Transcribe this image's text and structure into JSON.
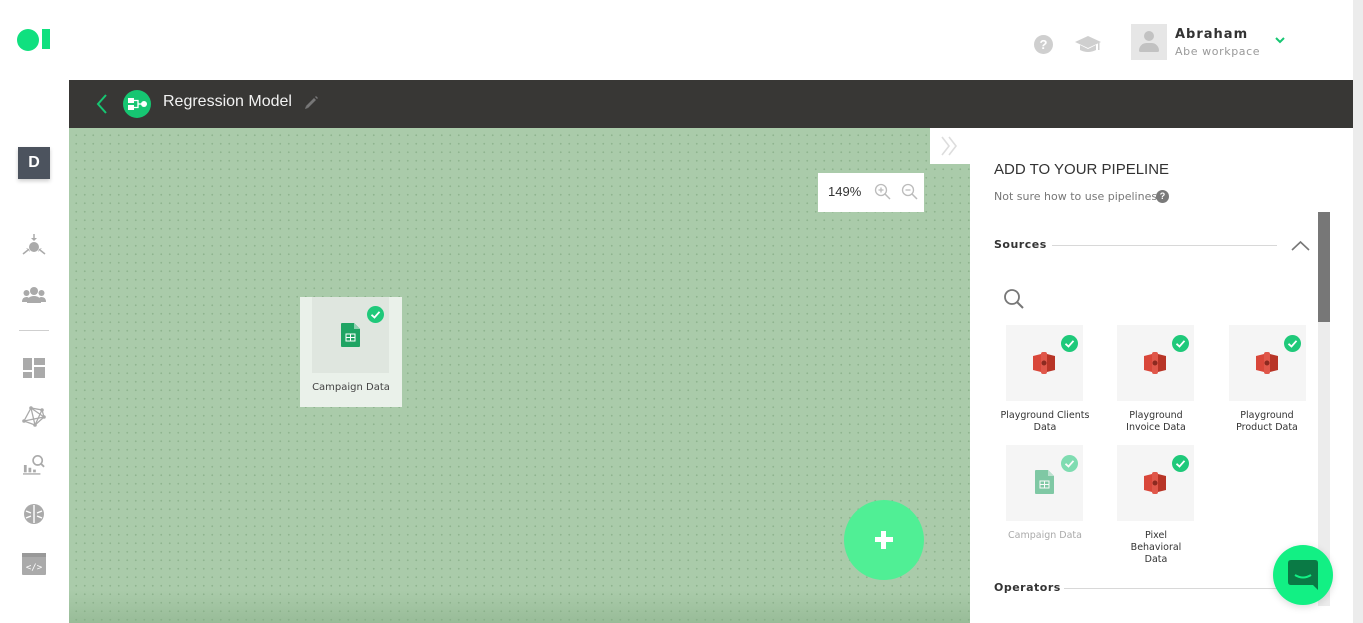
{
  "app": {
    "logo": "logo",
    "workspace_badge": "D"
  },
  "header": {
    "help_icon": "question-circle-icon",
    "academy_icon": "graduation-cap-icon",
    "user": {
      "name": "Abraham",
      "workspace": "Abe workpace",
      "avatar_icon": "user-avatar-icon",
      "menu_icon": "chevron-down-icon"
    }
  },
  "sidebar": {
    "items": [
      {
        "name": "sources",
        "icon": "converge-icon"
      },
      {
        "name": "audiences",
        "icon": "users-icon"
      },
      {
        "name": "dashboards",
        "icon": "dashboard-icon"
      },
      {
        "name": "network",
        "icon": "network-icon"
      },
      {
        "name": "analytics",
        "icon": "chart-search-icon"
      },
      {
        "name": "models",
        "icon": "brain-icon"
      },
      {
        "name": "api",
        "icon": "code-icon"
      }
    ]
  },
  "titlebar": {
    "back_icon": "chevron-left-icon",
    "pipeline_icon": "pipeline-icon",
    "title": "Regression Model",
    "edit_icon": "pencil-icon"
  },
  "canvas": {
    "zoom_level": "149%",
    "zoom_in_icon": "zoom-in-icon",
    "zoom_out_icon": "zoom-out-icon",
    "collapse_icon": "double-chevron-right-icon",
    "nodes": [
      {
        "label": "Campaign Data",
        "type": "google-sheets",
        "status": "connected"
      }
    ],
    "add_button_icon": "plus-icon"
  },
  "panel": {
    "title": "ADD TO YOUR PIPELINE",
    "subtitle": "Not sure how to use pipelines",
    "help_icon": "question-circle-icon",
    "sections": {
      "sources": {
        "label": "Sources",
        "expanded": true,
        "search_icon": "search-icon",
        "items": [
          {
            "label": "Playground Clients Data",
            "type": "amazon-s3",
            "status": "connected",
            "disabled": false
          },
          {
            "label": "Playground Invoice Data",
            "type": "amazon-s3",
            "status": "connected",
            "disabled": false
          },
          {
            "label": "Playground Product Data",
            "type": "amazon-s3",
            "status": "connected",
            "disabled": false
          },
          {
            "label": "Campaign Data",
            "type": "google-sheets",
            "status": "connected",
            "disabled": true
          },
          {
            "label": "Pixel Behavioral Data",
            "type": "amazon-s3",
            "status": "connected",
            "disabled": false
          }
        ]
      },
      "operators": {
        "label": "Operators"
      }
    }
  },
  "chat": {
    "icon": "chat-icon"
  },
  "colors": {
    "brand_green": "#10e07f",
    "canvas_bg": "#aacbaa",
    "titlebar_bg": "#383735",
    "check_green": "#1fc97a",
    "s3_red": "#d9473a",
    "sheets_green": "#1fa463"
  }
}
